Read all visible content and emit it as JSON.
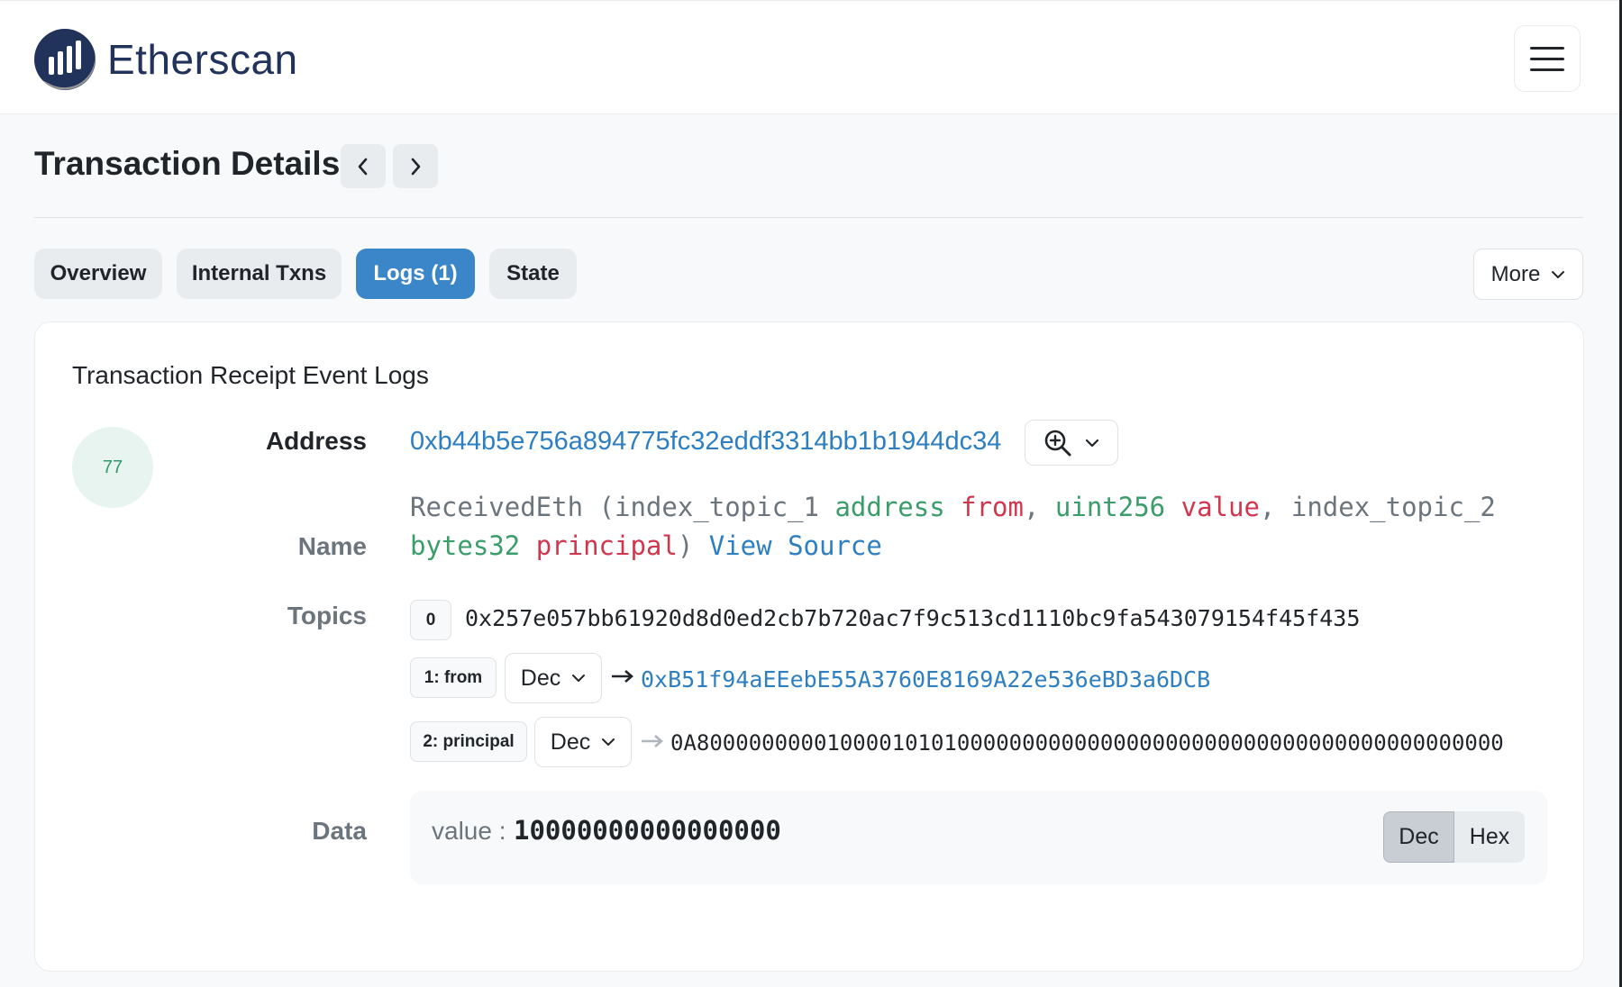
{
  "brand": {
    "name": "Etherscan"
  },
  "header": {
    "menu_icon": "hamburger-icon"
  },
  "page": {
    "title": "Transaction Details"
  },
  "tabs": [
    {
      "label": "Overview",
      "active": false
    },
    {
      "label": "Internal Txns",
      "active": false
    },
    {
      "label": "Logs (1)",
      "active": true
    },
    {
      "label": "State",
      "active": false
    }
  ],
  "more": {
    "label": "More"
  },
  "card": {
    "title": "Transaction Receipt Event Logs"
  },
  "log": {
    "index": "77",
    "labels": {
      "address": "Address",
      "name": "Name",
      "topics": "Topics",
      "data": "Data"
    },
    "address": "0xb44b5e756a894775fc32eddf3314bb1b1944dc34",
    "signature": {
      "event": "ReceivedEth",
      "open": "(",
      "param1_prefix": "index_topic_1",
      "param1_type": "address",
      "param1_name": "from",
      "comma": ",",
      "param2_type": "uint256",
      "param2_name": "value",
      "param3_prefix": "index_topic_2",
      "param3_type": "bytes32",
      "param3_name": "principal",
      "close": ")",
      "view_source": "View Source"
    },
    "topics": [
      {
        "badge": "0",
        "value": "0x257e057bb61920d8d0ed2cb7b720ac7f9c513cd1110bc9fa543079154f45f435"
      },
      {
        "badge": "1: from",
        "format": "Dec",
        "value": "0xB51f94aEEebE55A3760E8169A22e536eBD3a6DCB"
      },
      {
        "badge": "2: principal",
        "format": "Dec",
        "value": "0A80000000001000010101000000000000000000000000000000000000000000"
      }
    ],
    "data": {
      "key": "value :",
      "value": "10000000000000000",
      "toggle": [
        "Dec",
        "Hex"
      ],
      "selected": "Dec"
    }
  },
  "colors": {
    "accent": "#3a86c8",
    "link": "#2d7fc2",
    "type": "#3a9d6a",
    "name": "#d1364f"
  }
}
